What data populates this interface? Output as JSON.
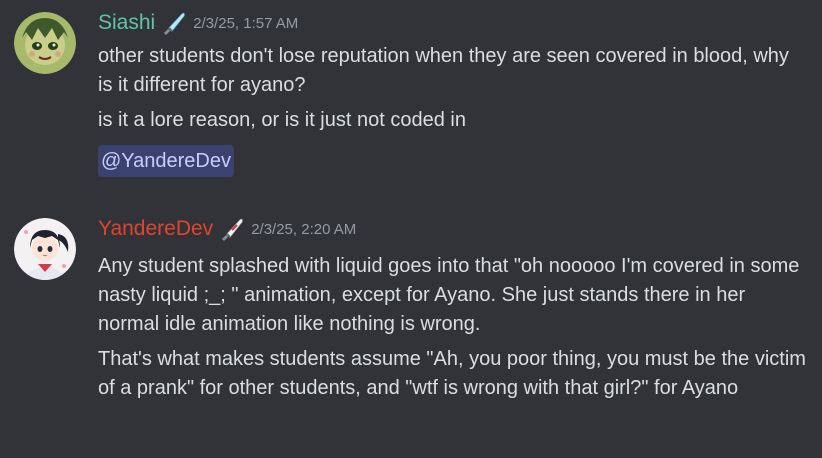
{
  "messages": [
    {
      "username": "Siashi",
      "username_color": "#5ec7a1",
      "role_icon": "knife-icon",
      "timestamp": "2/3/25, 1:57 AM",
      "lines": [
        "other students don't lose reputation when they are seen covered in blood, why is it different for ayano?",
        "is it a lore reason, or is it just not coded in"
      ],
      "mention": "@YandereDev"
    },
    {
      "username": "YandereDev",
      "username_color": "#e0442d",
      "role_icon": "knife-icon",
      "timestamp": "2/3/25, 2:20 AM",
      "lines": [
        "Any student splashed with liquid goes into that \"oh nooooo I'm covered in some nasty liquid ;_; \" animation, except for Ayano. She just stands there in her normal idle animation like nothing is wrong.",
        "That's what makes students assume \"Ah, you poor thing, you must be the victim of a prank\" for other students, and \"wtf is wrong with that girl?\" for Ayano"
      ]
    }
  ]
}
